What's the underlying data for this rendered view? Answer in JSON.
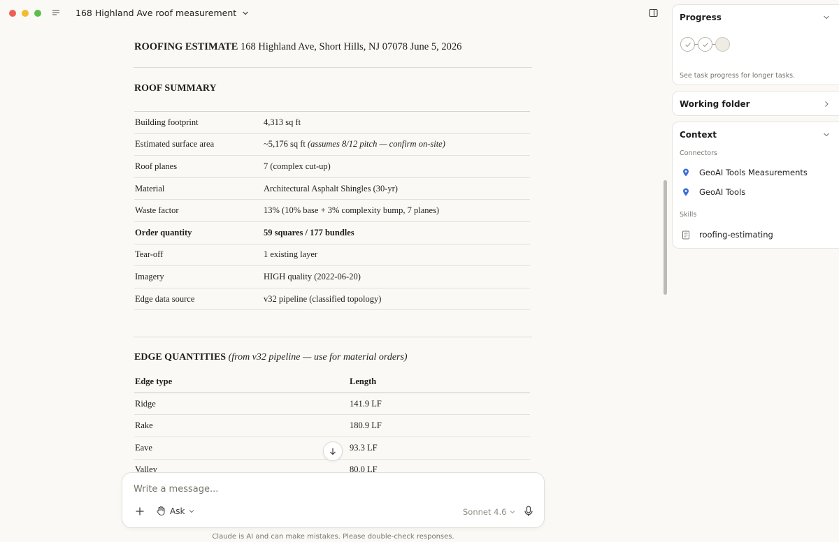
{
  "window": {
    "title": "168 Highland Ave roof measurement"
  },
  "document": {
    "header_bold": "ROOFING ESTIMATE",
    "header_rest": " 168 Highland Ave, Short Hills, NJ 07078 June 5, 2026",
    "roof_summary": {
      "title": "ROOF SUMMARY",
      "rows": [
        {
          "key": "Building footprint",
          "value": "4,313 sq ft",
          "note": "",
          "bold": false
        },
        {
          "key": "Estimated surface area",
          "value": "~5,176 sq ft ",
          "note": "(assumes 8/12 pitch — confirm on-site)",
          "bold": false
        },
        {
          "key": "Roof planes",
          "value": "7 (complex cut-up)",
          "note": "",
          "bold": false
        },
        {
          "key": "Material",
          "value": "Architectural Asphalt Shingles (30-yr)",
          "note": "",
          "bold": false
        },
        {
          "key": "Waste factor",
          "value": "13% (10% base + 3% complexity bump, 7 planes)",
          "note": "",
          "bold": false
        },
        {
          "key": "Order quantity",
          "value": "59 squares / 177 bundles",
          "note": "",
          "bold": true
        },
        {
          "key": "Tear-off",
          "value": "1 existing layer",
          "note": "",
          "bold": false
        },
        {
          "key": "Imagery",
          "value": "HIGH quality (2022-06-20)",
          "note": "",
          "bold": false
        },
        {
          "key": "Edge data source",
          "value": "v32 pipeline (classified topology)",
          "note": "",
          "bold": false
        }
      ]
    },
    "edge_quantities": {
      "title_bold": "EDGE QUANTITIES",
      "title_italic": " (from v32 pipeline — use for material orders)",
      "col_type": "Edge type",
      "col_length": "Length",
      "rows": [
        {
          "type": "Ridge",
          "length": "141.9 LF"
        },
        {
          "type": "Rake",
          "length": "180.9 LF"
        },
        {
          "type": "Eave",
          "length": "93.3 LF"
        },
        {
          "type": "Valley",
          "length": "80.0 LF"
        }
      ]
    }
  },
  "composer": {
    "placeholder": "Write a message...",
    "mode_label": "Ask",
    "model_label": "Sonnet 4.6",
    "disclaimer": "Claude is AI and can make mistakes. Please double-check responses."
  },
  "sidebar": {
    "progress": {
      "title": "Progress",
      "note": "See task progress for longer tasks.",
      "steps": [
        "done",
        "done",
        "pending"
      ]
    },
    "working_folder": {
      "title": "Working folder"
    },
    "context": {
      "title": "Context",
      "connectors_label": "Connectors",
      "connectors": [
        {
          "label": "GeoAI Tools Measurements",
          "icon": "map-pin-icon"
        },
        {
          "label": "GeoAI Tools",
          "icon": "map-pin-icon"
        }
      ],
      "skills_label": "Skills",
      "skills": [
        {
          "label": "roofing-estimating",
          "icon": "document-icon"
        }
      ]
    }
  },
  "colors": {
    "background": "#faf9f5",
    "accent_pin": "#3b6fd8",
    "traffic_red": "#ee5e56",
    "traffic_yellow": "#f3bb2f",
    "traffic_green": "#5cc048"
  }
}
